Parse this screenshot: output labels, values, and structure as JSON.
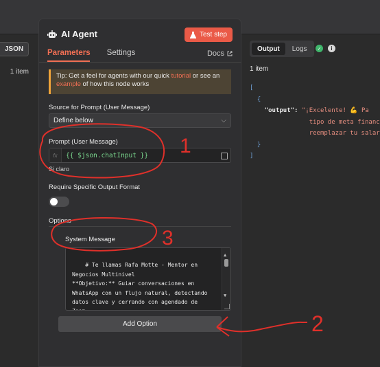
{
  "left": {
    "json_tab": "JSON",
    "item_count": "1 item"
  },
  "node": {
    "title": "AI Agent",
    "test_step": "Test step",
    "tabs": [
      "Parameters",
      "Settings"
    ],
    "docs": "Docs",
    "tip": {
      "prefix": "Tip: Get a feel for agents with our quick ",
      "link1": "tutorial",
      "middle": " or see an ",
      "link2": "example",
      "suffix": " of how this node works"
    },
    "source_label": "Source for Prompt (User Message)",
    "source_value": "Define below",
    "prompt_label": "Prompt (User Message)",
    "prompt_fx": "fx",
    "prompt_value": "{{ $json.chatInput }}",
    "prompt_preview": "Si claro",
    "require_label": "Require Specific Output Format",
    "options_label": "Options",
    "system_label": "System Message",
    "system_value": "# Te llamas Rafa Motte - Mentor en Negocios Multinivel\n**Objetivo:** Guiar conversaciones en WhatsApp con un flujo natural, detectando datos clave y cerrando con agendado de Zoom.",
    "add_option": "Add Option"
  },
  "output": {
    "tabs": [
      "Output",
      "Logs"
    ],
    "item_count": "1 item",
    "open_bracket": "[",
    "open_brace": "{",
    "key": "\"output\"",
    "colon": ": ",
    "line1": "\"¡Excelente! 💪 Pa",
    "line2": "tipo de meta financ",
    "line3": "reemplazar tu salar",
    "close_brace": "}",
    "close_bracket": "]"
  },
  "annotations": {
    "one": "1",
    "two": "2",
    "three": "3"
  },
  "colors": {
    "accent": "#f26f54",
    "test_button": "#ea5a47",
    "annotation": "#e0302a",
    "success": "#3fb56b"
  }
}
